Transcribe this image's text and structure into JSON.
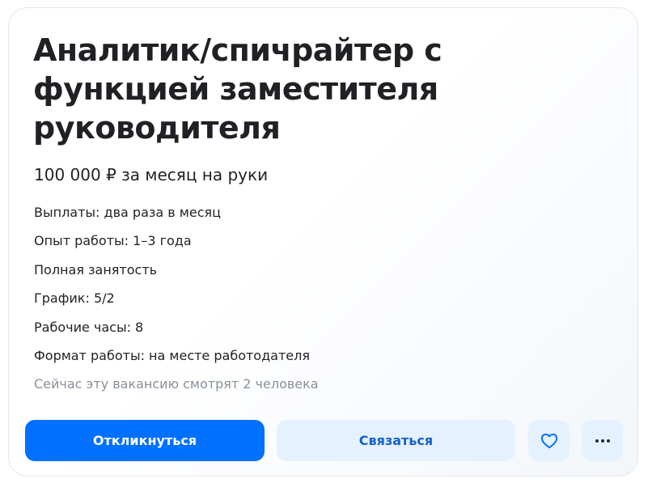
{
  "vacancy": {
    "title": "Аналитик/спичрайтер с функцией заместителя руководителя",
    "salary": "100 000 ₽ за месяц на руки",
    "facts": [
      "Выплаты: два раза в месяц",
      "Опыт работы: 1–3 года",
      "Полная занятость",
      "График: 5/2",
      "Рабочие часы: 8",
      "Формат работы: на месте работодателя"
    ],
    "viewers": "Сейчас эту вакансию смотрят 2 человека"
  },
  "actions": {
    "respond_label": "Откликнуться",
    "contact_label": "Связаться",
    "favorite_icon": "heart-icon",
    "more_icon": "more-horizontal-icon"
  },
  "colors": {
    "primary": "#0070ff",
    "secondary_bg": "#e6f1ff",
    "secondary_text": "#1560c9",
    "text": "#1f2124",
    "muted": "#8a9099"
  }
}
